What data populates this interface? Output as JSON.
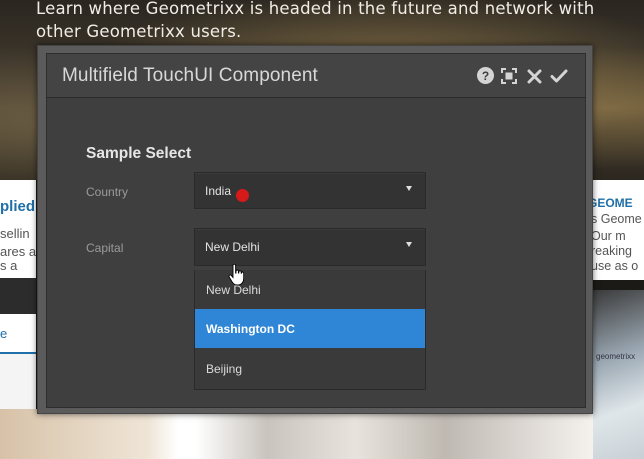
{
  "background": {
    "hero_text": "Learn where Geometrixx is headed in the future and network with other Geometrixx users.",
    "left_title": "plied",
    "left_lines": [
      "sellin",
      "ares a",
      "s a"
    ],
    "left_tab": "e",
    "right_title": "GEOME",
    "right_lines": [
      "s Geome",
      "Our m",
      "reaking",
      "use as o"
    ],
    "phone_brand": "geometrixx"
  },
  "dialog": {
    "title": "Multifield TouchUI Component",
    "header_icons": [
      "help-icon",
      "fullscreen-icon",
      "close-icon",
      "done-icon"
    ],
    "help_glyph": "?",
    "section_title": "Sample Select",
    "fields": {
      "country": {
        "label": "Country",
        "value": "India"
      },
      "capital": {
        "label": "Capital",
        "value": "New Delhi"
      }
    },
    "dropdown": {
      "options": [
        "New Delhi",
        "Washington DC",
        "Beijing"
      ],
      "highlighted": "Washington DC"
    }
  },
  "colors": {
    "accent": "#2f86d6",
    "link": "#1f6fa8",
    "cursor_dot": "#d61a1a"
  }
}
